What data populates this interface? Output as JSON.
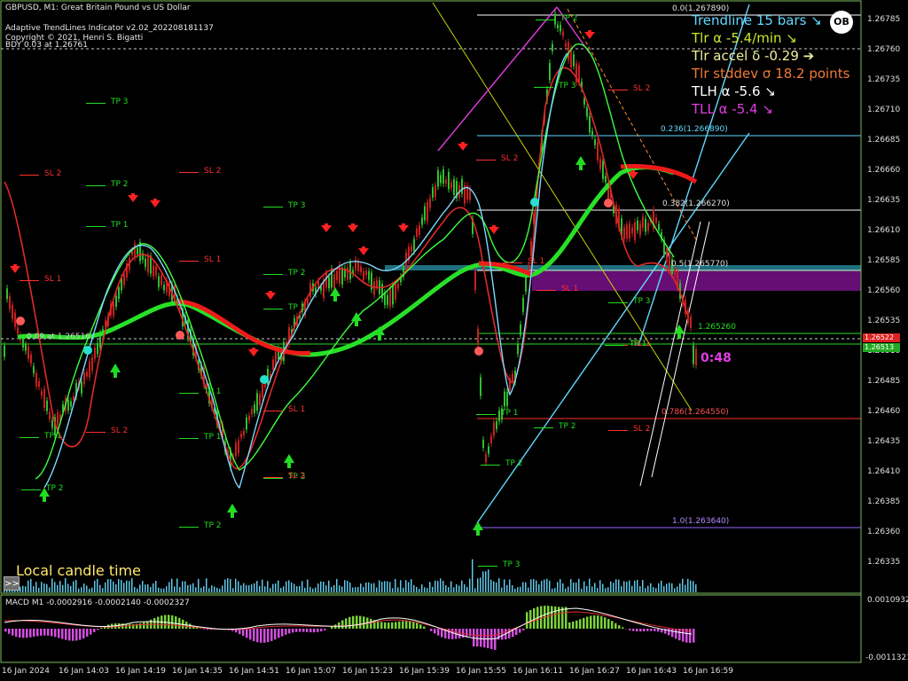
{
  "header": {
    "symbol_line": "GBPUSD, M1:  Great Britain Pound vs US Dollar",
    "indicator_line": "Adaptive TrendLines Indicator v2.02_202208181137",
    "copyright_line": "Copyright © 2021, Henri S. Bigatti",
    "bdy_line": "BDY 0.03 at 1.26761"
  },
  "panel": {
    "line1": "Trendline 15 bars ↘",
    "line2": "Tlr α -5.4/min ↘",
    "line3": "Tlr accel δ -0.29 ➔",
    "line4": "Tlr stddev σ 18.2 points",
    "line5": "TLH α -5.6 ↘",
    "line6": "TLL α -5.4 ↘"
  },
  "colors": {
    "bullish_arrow": "#22dd22",
    "bearish_arrow": "#ff2020",
    "cyan_line": "#60d8ff",
    "magenta": "#e23ce2",
    "purple_zone": "#6a0f7a",
    "teal_zone": "#1f6f7f"
  },
  "price_axis": [
    "1.26785",
    "1.26760",
    "1.26735",
    "1.26710",
    "1.26685",
    "1.26660",
    "1.26635",
    "1.26610",
    "1.26585",
    "1.26560",
    "1.26535",
    "1.26510",
    "1.26485",
    "1.26460",
    "1.26435",
    "1.26410",
    "1.26385",
    "1.26360",
    "1.26335"
  ],
  "current_prices": [
    "1.26522",
    "1.26513"
  ],
  "time_axis": [
    "16 Jan 2024",
    "16 Jan 14:03",
    "16 Jan 14:19",
    "16 Jan 14:35",
    "16 Jan 14:51",
    "16 Jan 15:07",
    "16 Jan 15:23",
    "16 Jan 15:39",
    "16 Jan 15:55",
    "16 Jan 16:11",
    "16 Jan 16:27",
    "16 Jan 16:43",
    "16 Jan 16:59"
  ],
  "fib_levels": [
    {
      "label": "0.0(1.267890)",
      "color": "#ffffff"
    },
    {
      "label": "0.236(1.266890)",
      "color": "#60d8ff"
    },
    {
      "label": "0.382(1.266270)",
      "color": "#ffffff"
    },
    {
      "label": "0.5(1.265770)",
      "color": "#ffffff"
    },
    {
      "label": "1.265260",
      "color": "#22dd22"
    },
    {
      "label": "0.786(1.264550)",
      "color": "#ff3030"
    },
    {
      "label": "1.0(1.263640)",
      "color": "#9a66ff"
    }
  ],
  "level_left_label": "0.09 at 1.26516",
  "tp_sl_labels": [
    {
      "text": "TP 3",
      "color": "#22dd22"
    },
    {
      "text": "SL 2",
      "color": "#ff3030"
    },
    {
      "text": "TP 2",
      "color": "#22dd22"
    },
    {
      "text": "SL 2",
      "color": "#ff3030"
    },
    {
      "text": "TP 1",
      "color": "#22dd22"
    },
    {
      "text": "SL 1",
      "color": "#ff3030"
    },
    {
      "text": "SL 1",
      "color": "#ff3030"
    },
    {
      "text": "TP 3",
      "color": "#22dd22"
    },
    {
      "text": "TP 2",
      "color": "#22dd22"
    },
    {
      "text": "TP 1",
      "color": "#22dd22"
    },
    {
      "text": "TP 1",
      "color": "#22dd22"
    },
    {
      "text": "TP 1",
      "color": "#22dd22"
    },
    {
      "text": "TP 1",
      "color": "#22dd22"
    },
    {
      "text": "SL 2",
      "color": "#ff3030"
    },
    {
      "text": "SL 1",
      "color": "#ff3030"
    },
    {
      "text": "TP 2",
      "color": "#22dd22"
    },
    {
      "text": "TP 2",
      "color": "#22dd22"
    },
    {
      "text": "TP 3",
      "color": "#22dd22"
    },
    {
      "text": "SL 2",
      "color": "#ff3030"
    },
    {
      "text": "SL 2",
      "color": "#ff3030"
    },
    {
      "text": "TP 2",
      "color": "#22dd22"
    },
    {
      "text": "TP 3",
      "color": "#22dd22"
    },
    {
      "text": "SL 1",
      "color": "#ff3030"
    },
    {
      "text": "SL 1",
      "color": "#ff3030"
    },
    {
      "text": "TP 1",
      "color": "#22dd22"
    },
    {
      "text": "TP 2",
      "color": "#22dd22"
    },
    {
      "text": "TP 3",
      "color": "#22dd22"
    },
    {
      "text": "SL 2",
      "color": "#ff3030"
    },
    {
      "text": "TP 2",
      "color": "#22dd22"
    },
    {
      "text": "TP 3",
      "color": "#22dd22"
    },
    {
      "text": "SL 2",
      "color": "#ff3030"
    },
    {
      "text": "SL 1",
      "color": "#ff3030"
    },
    {
      "text": "TP 1",
      "color": "#22dd22"
    },
    {
      "text": "TP 1",
      "color": "#22dd22"
    }
  ],
  "local_time_label": "Local candle time",
  "toggle_label": ">>",
  "countdown": "0:48",
  "logo_text": "OB",
  "macd": {
    "title": "MACD M1 -0.0002916 -0.0002140 -0.0002327",
    "axis_top": "0.0010932",
    "axis_bottom": "-0.0011321"
  }
}
